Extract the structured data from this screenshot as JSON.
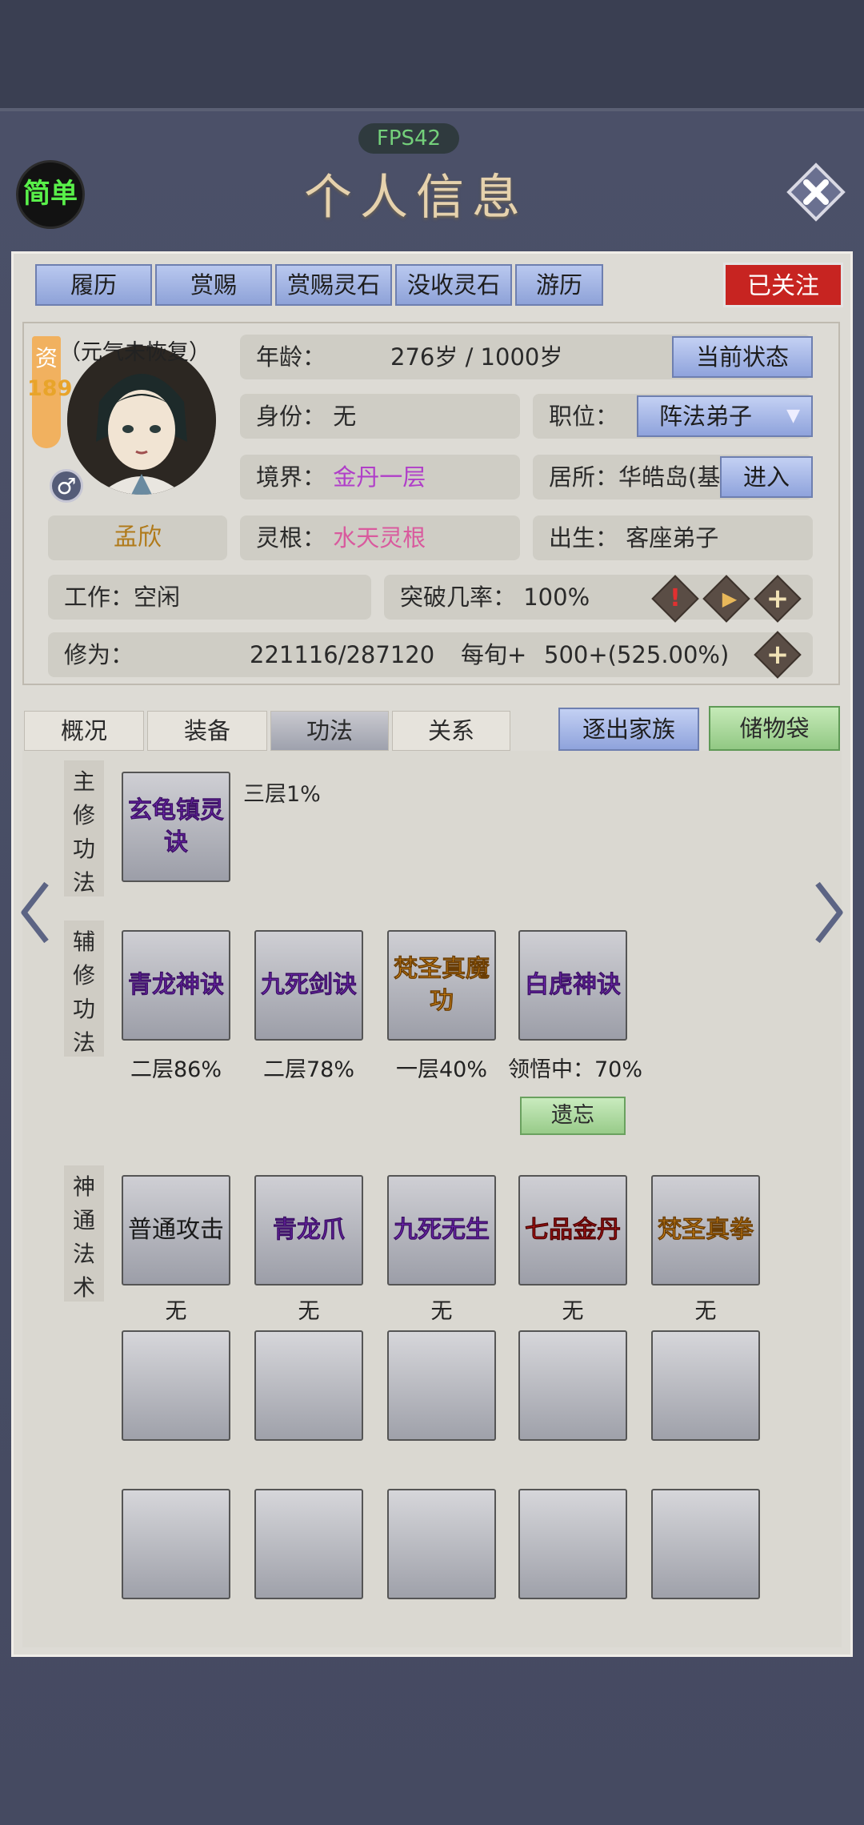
{
  "fps": "FPS42",
  "header": {
    "simple_label": "简单",
    "title": "个人信息"
  },
  "top_tabs": [
    "履历",
    "赏赐",
    "赏赐灵石",
    "没收灵石",
    "游历"
  ],
  "follow_label": "已关注",
  "profile": {
    "aptitude_char": "资",
    "aptitude_value": "189",
    "status_note": "（元气未恢复）",
    "name": "孟欣",
    "gender_symbol": "♂",
    "age_label": "年龄：",
    "age_value": "276岁 / 1000岁",
    "current_state_button": "当前状态",
    "identity_label": "身份：",
    "identity_value": "无",
    "position_label": "职位：",
    "position_value": "阵法弟子",
    "realm_label": "境界：",
    "realm_value": "金丹一层",
    "residence_label": "居所：华皓岛(基",
    "enter_button": "进入",
    "root_label": "灵根：",
    "root_value": "水天灵根",
    "birth_label": "出生：",
    "birth_value": "客座弟子",
    "work_label": "工作：空闲",
    "breakthrough_label": "突破几率：",
    "breakthrough_value": "100%",
    "cultivation_label": "修为：",
    "cultivation_value": "221116/287120",
    "per_period_label": "每旬+",
    "per_period_value": "500+(525.00%)"
  },
  "lower_tabs": [
    "概况",
    "装备",
    "功法",
    "关系"
  ],
  "active_lower_tab": "功法",
  "expel_button": "逐出家族",
  "bag_button": "储物袋",
  "main_skill": {
    "label": [
      "主",
      "修",
      "功",
      "法"
    ],
    "name": "玄龟镇灵诀",
    "progress": "三层1%"
  },
  "aux_skills": {
    "label": [
      "辅",
      "修",
      "功",
      "法"
    ],
    "items": [
      {
        "name": "青龙神诀",
        "progress": "二层86%",
        "color": "purple"
      },
      {
        "name": "九死剑诀",
        "progress": "二层78%",
        "color": "purple"
      },
      {
        "name": "梵圣真魔功",
        "progress": "一层40%",
        "color": "orange"
      },
      {
        "name": "白虎神诀",
        "progress": "领悟中：70%",
        "color": "purple"
      }
    ],
    "forget_button": "遗忘"
  },
  "magic_skills": {
    "label": [
      "神",
      "通",
      "法",
      "术"
    ],
    "items": [
      {
        "name": "普通攻击",
        "level": "无",
        "color": "black"
      },
      {
        "name": "青龙爪",
        "level": "无",
        "color": "purple"
      },
      {
        "name": "九死无生",
        "level": "无",
        "color": "purple"
      },
      {
        "name": "七品金丹",
        "level": "无",
        "color": "red"
      },
      {
        "name": "梵圣真拳",
        "level": "无",
        "color": "orange"
      }
    ]
  }
}
